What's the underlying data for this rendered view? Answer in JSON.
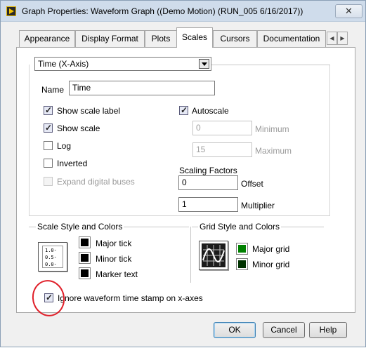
{
  "window": {
    "title": "Graph Properties: Waveform Graph ((Demo Motion) (RUN_005 6/16/2017))",
    "close_glyph": "✕"
  },
  "tabs": [
    {
      "label": "Appearance"
    },
    {
      "label": "Display Format"
    },
    {
      "label": "Plots"
    },
    {
      "label": "Scales",
      "active": true
    },
    {
      "label": "Cursors"
    },
    {
      "label": "Documentation"
    }
  ],
  "tab_scroll": {
    "left_glyph": "◀",
    "right_glyph": "▶"
  },
  "axis_select": {
    "value": "Time (X-Axis)"
  },
  "name": {
    "label": "Name",
    "value": "Time"
  },
  "options": {
    "show_scale_label": {
      "label": "Show scale label",
      "checked": true
    },
    "show_scale": {
      "label": "Show scale",
      "checked": true
    },
    "log": {
      "label": "Log",
      "checked": false
    },
    "inverted": {
      "label": "Inverted",
      "checked": false
    },
    "expand_digital_buses": {
      "label": "Expand digital buses",
      "checked": false,
      "disabled": true
    }
  },
  "autoscale": {
    "label": "Autoscale",
    "checked": true
  },
  "minimum": {
    "label": "Minimum",
    "value": "0"
  },
  "maximum": {
    "label": "Maximum",
    "value": "15"
  },
  "scaling_factors": {
    "title": "Scaling Factors",
    "offset_label": "Offset",
    "offset_value": "0",
    "multiplier_label": "Multiplier",
    "multiplier_value": "1"
  },
  "scale_style": {
    "title": "Scale Style and Colors",
    "preview_labels": [
      "1.0-",
      "0.5-",
      "0.0-"
    ],
    "items": [
      {
        "label": "Major tick",
        "color": "#000000"
      },
      {
        "label": "Minor tick",
        "color": "#000000"
      },
      {
        "label": "Marker text",
        "color": "#000000"
      }
    ]
  },
  "grid_style": {
    "title": "Grid Style and Colors",
    "items": [
      {
        "label": "Major grid",
        "color": "#008000"
      },
      {
        "label": "Minor grid",
        "color": "#003300"
      }
    ]
  },
  "ignore_timestamp": {
    "label": "Ignore waveform time stamp on x-axes",
    "checked": true
  },
  "buttons": {
    "ok": "OK",
    "cancel": "Cancel",
    "help": "Help"
  },
  "colors": {
    "annotation_circle": "#e0202a",
    "title_bar": "#cfdceb"
  }
}
